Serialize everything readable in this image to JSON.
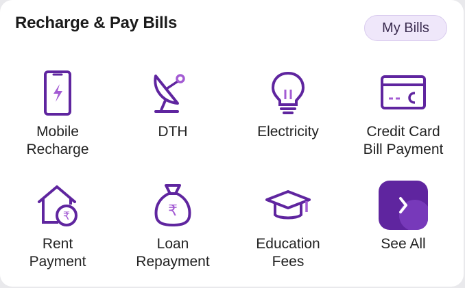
{
  "header": {
    "title": "Recharge & Pay Bills",
    "my_bills_label": "My Bills"
  },
  "tiles": [
    {
      "label": "Mobile\nRecharge",
      "icon": "mobile-recharge-icon"
    },
    {
      "label": "DTH",
      "icon": "satellite-dish-icon"
    },
    {
      "label": "Electricity",
      "icon": "lightbulb-icon"
    },
    {
      "label": "Credit Card\nBill Payment",
      "icon": "credit-card-icon"
    },
    {
      "label": "Rent\nPayment",
      "icon": "house-rupee-icon"
    },
    {
      "label": "Loan\nRepayment",
      "icon": "money-bag-icon"
    },
    {
      "label": "Education\nFees",
      "icon": "graduation-cap-icon"
    },
    {
      "label": "See All",
      "icon": "chevron-right-icon"
    }
  ],
  "colors": {
    "accent": "#5f259f",
    "accent_light": "#a35bd3",
    "chip_bg": "#efe7fa"
  }
}
